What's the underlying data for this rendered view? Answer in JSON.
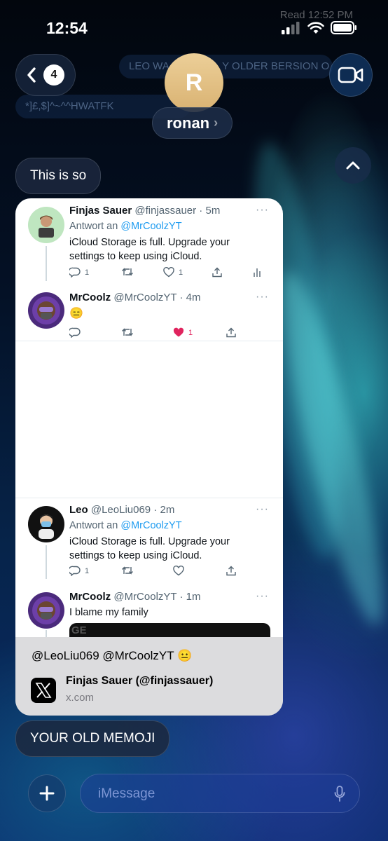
{
  "status_bar": {
    "time": "12:54",
    "read_receipt": "Read 12:52 PM"
  },
  "header": {
    "back_count": "4",
    "avatar_initial": "R",
    "contact_name": "ronan",
    "name_chevron": "›",
    "icons": [
      "chevron-left-icon",
      "video-camera-icon",
      "chevron-up-icon"
    ]
  },
  "background_messages": {
    "top_sent": "LEO WA",
    "top_sent_2": "Y OLDER BERSION O",
    "garbled": "*]£,$]^~^^HWATFK"
  },
  "messages": {
    "first": "This is so",
    "last": "YOUR OLD MEMOJI"
  },
  "link_preview": {
    "tweets": [
      {
        "name": "Finjas Sauer",
        "handle": "@finjassauer · 5m",
        "reply_prefix": "Antwort an ",
        "reply_to": "@MrCoolzYT",
        "text": "iCloud Storage is full. Upgrade your settings to keep using iCloud.",
        "replies": "1",
        "likes": "1"
      },
      {
        "name": "MrCoolz",
        "handle": "@MrCoolzYT · 4m",
        "text": "😑",
        "likes": "1"
      },
      {
        "name": "Leo",
        "handle": "@LeoLiu069 · 2m",
        "reply_prefix": "Antwort an ",
        "reply_to": "@MrCoolzYT",
        "text": "iCloud Storage is full. Upgrade your settings to keep using iCloud.",
        "replies": "1"
      },
      {
        "name": "MrCoolz",
        "handle": "@MrCoolzYT · 1m",
        "text": "I blame my family",
        "image_strip": "GE"
      }
    ],
    "more_glyph": "···",
    "caption": "@LeoLiu069 @MrCoolzYT 😐",
    "title": "Finjas Sauer (@finjassauer)",
    "domain": "x.com"
  },
  "input": {
    "placeholder": "iMessage"
  },
  "colors": {
    "accent": "#1d9bf0",
    "like": "#e0245e",
    "avatar_gold": "#e0bd80"
  }
}
